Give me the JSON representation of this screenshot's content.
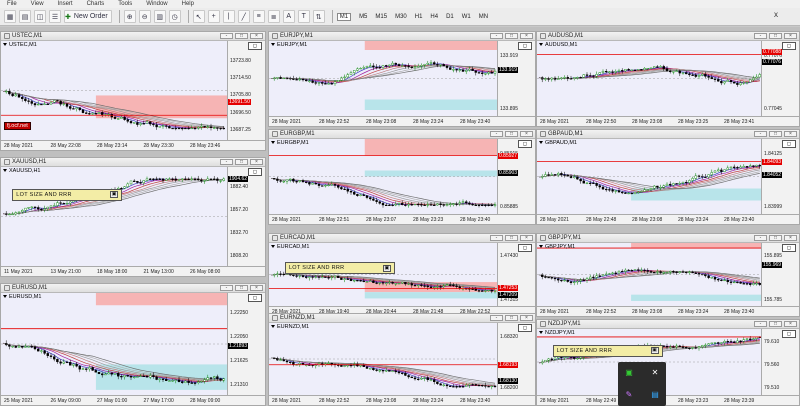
{
  "menu": [
    "File",
    "View",
    "Insert",
    "Charts",
    "Tools",
    "Window",
    "Help"
  ],
  "toolbar": {
    "new_order": "New Order",
    "timeframes": [
      "M1",
      "M5",
      "M15",
      "M30",
      "H1",
      "H4",
      "D1",
      "W1",
      "MN"
    ],
    "active_tf": "M1",
    "close_glyph": "x"
  },
  "panel_buttons": [
    "-",
    "□",
    "×"
  ],
  "overlay": {
    "lot_label": "LOT SIZE AND RRR",
    "watermark": "fj.ocf.net",
    "icon_camera": "camera-icon"
  },
  "colors": {
    "chart_bg": "#eeeefa",
    "bull": "#008000",
    "bear": "#000000",
    "band_red": "#f6b4b4",
    "band_cyan": "#b8e4ea",
    "hline_red": "#e60000",
    "ma_blue": "#4040c0",
    "ma_purple": "#a020a0",
    "ma_gray": "#9a9a9a"
  },
  "charts": [
    {
      "id": "ustec",
      "title": "USTEC,M1",
      "symbol": "USTEC,M1",
      "prices": [
        "13723.80",
        "13714.50",
        "13705.80",
        "13696.50",
        "13687.25"
      ],
      "tag_red": "13691.50",
      "tag_red_pos": 0.62,
      "tag_blk": "",
      "times": [
        "28 May 2021",
        "28 May 22:08",
        "28 May 23:14",
        "28 May 23:30",
        "28 May 23:46"
      ],
      "bands": {
        "red": [
          0.55,
          0.78
        ],
        "cyan": null
      },
      "hline": 0.75,
      "trend": "down",
      "seed": 1,
      "watermark": true,
      "lot": false
    },
    {
      "id": "eurjpy",
      "title": "EURJPY,M1",
      "symbol": "EURJPY,M1",
      "prices": [
        "133.919",
        "133.895"
      ],
      "tag_red": "",
      "tag_red_pos": 0,
      "tag_blk": "133.919",
      "tag_blk_pos": 0.38,
      "times": [
        "28 May 2021",
        "28 May 22:52",
        "28 May 23:08",
        "28 May 23:24",
        "28 May 23:40"
      ],
      "bands": {
        "red": [
          0.0,
          0.12
        ],
        "cyan": [
          0.78,
          0.92
        ]
      },
      "hline": null,
      "trend": "mixed",
      "seed": 2,
      "lot": false
    },
    {
      "id": "audusd",
      "title": "AUDUSD,M1",
      "symbol": "AUDUSD,M1",
      "prices": [
        "0.77076",
        "0.77045"
      ],
      "tag_red": "0.77088",
      "tag_red_pos": 0.15,
      "tag_blk": "0.77076",
      "tag_blk_pos": 0.28,
      "times": [
        "28 May 2021",
        "28 May 22:50",
        "28 May 23:08",
        "28 May 23:25",
        "28 May 23:41"
      ],
      "bands": {
        "red": null,
        "cyan": null
      },
      "hline": 0.18,
      "trend": "mixed",
      "seed": 3,
      "lot": false
    },
    {
      "id": "xauusd",
      "title": "XAUUSD,H1",
      "symbol": "XAUUSD,H1",
      "prices": [
        "1882.40",
        "1857.20",
        "1832.70",
        "1808.20"
      ],
      "tag_red": "",
      "tag_red_pos": 0,
      "tag_blk": "1904.62",
      "tag_blk_pos": 0.12,
      "times": [
        "11 May 2021",
        "13 May 21:00",
        "18 May 18:00",
        "21 May 13:00",
        "26 May 08:00"
      ],
      "bands": {
        "red": null,
        "cyan": null
      },
      "hline": null,
      "trend": "up",
      "seed": 4,
      "lot": true,
      "lot_pos": [
        0.05,
        0.14
      ]
    },
    {
      "id": "eurgbp",
      "title": "EURGBP,M1",
      "symbol": "EURGBP,M1",
      "prices": [
        "0.85915",
        "0.85885"
      ],
      "tag_red": "0.85927",
      "tag_red_pos": 0.22,
      "tag_blk": "0.85903",
      "tag_blk_pos": 0.45,
      "times": [
        "28 May 2021",
        "28 May 22:51",
        "28 May 23:07",
        "28 May 23:23",
        "28 May 23:40"
      ],
      "bands": {
        "red": [
          0.0,
          0.22
        ],
        "cyan": [
          0.42,
          0.5
        ]
      },
      "hline": 0.22,
      "trend": "down",
      "seed": 5,
      "lot": false
    },
    {
      "id": "gbpaud",
      "title": "GBPAUD,M1",
      "symbol": "GBPAUD,M1",
      "prices": [
        "1.84125",
        "1.83999"
      ],
      "tag_red": "1.84093",
      "tag_red_pos": 0.3,
      "tag_blk": "1.84052",
      "tag_blk_pos": 0.48,
      "times": [
        "28 May 2021",
        "28 May 22:48",
        "28 May 23:08",
        "28 May 23:24",
        "28 May 23:40"
      ],
      "bands": {
        "red": null,
        "cyan": [
          0.66,
          0.82
        ]
      },
      "hline": 0.3,
      "trend": "mixed",
      "seed": 6,
      "lot": false
    },
    {
      "id": "eurcad",
      "title": "EURCAD,M1",
      "symbol": "EURCAD,M1",
      "prices": [
        "1.47430",
        "1.47315"
      ],
      "tag_red": "1.47253",
      "tag_red_pos": 0.72,
      "tag_blk": "1.47209",
      "tag_blk_pos": 0.83,
      "times": [
        "28 May 2021",
        "28 May 19:40",
        "28 May 20:44",
        "28 May 21:48",
        "28 May 22:52"
      ],
      "bands": {
        "red": [
          0.62,
          0.78
        ],
        "cyan": [
          0.78,
          0.88
        ]
      },
      "hline": 0.72,
      "trend": "down",
      "seed": 7,
      "lot": true,
      "lot_pos": [
        0.07,
        0.18
      ]
    },
    {
      "id": "gbpjpy",
      "title": "GBPJPY,M1",
      "symbol": "GBPJPY,M1",
      "prices": [
        "155.895",
        "155.785"
      ],
      "tag_red": "",
      "tag_red_pos": 0,
      "tag_blk": "155.969",
      "tag_blk_pos": 0.35,
      "times": [
        "28 May 2021",
        "28 May 22:52",
        "28 May 23:08",
        "28 May 23:24",
        "28 May 23:40"
      ],
      "bands": {
        "red": [
          0.0,
          0.08
        ],
        "cyan": [
          0.82,
          0.92
        ]
      },
      "hline": 0.08,
      "trend": "mixed",
      "seed": 8,
      "lot": false
    },
    {
      "id": "eurusd",
      "title": "EURUSD,M1",
      "symbol": "EURUSD,M1",
      "prices": [
        "1.22250",
        "1.22050",
        "1.21625",
        "1.21310"
      ],
      "tag_red": "",
      "tag_red_pos": 0,
      "tag_blk": "1.21893",
      "tag_blk_pos": 0.52,
      "times": [
        "25 May 2021",
        "26 May 09:00",
        "27 May 01:00",
        "27 May 17:00",
        "28 May 09:00"
      ],
      "bands": {
        "red": [
          0.0,
          0.12
        ],
        "cyan": [
          0.7,
          0.95
        ]
      },
      "hline": 0.35,
      "trend": "down",
      "seed": 9,
      "lot": false
    },
    {
      "id": "eurnzd",
      "title": "EURNZD,M1",
      "symbol": "EURNZD,M1",
      "prices": [
        "1.68320",
        "1.68200"
      ],
      "tag_red": "1.68193",
      "tag_red_pos": 0.58,
      "tag_blk": "1.68130",
      "tag_blk_pos": 0.8,
      "times": [
        "28 May 2021",
        "28 May 22:52",
        "28 May 23:08",
        "28 May 23:24",
        "28 May 23:40"
      ],
      "bands": {
        "red": null,
        "cyan": null
      },
      "hline": 0.58,
      "trend": "down",
      "seed": 10,
      "lot": false
    },
    {
      "id": "nzdjpy",
      "title": "NZDJPY,M1",
      "symbol": "NZDJPY,M1",
      "prices": [
        "79.610",
        "79.560",
        "79.510"
      ],
      "tag_red": "",
      "tag_red_pos": 0,
      "tag_blk": "",
      "times": [
        "28 May 2021",
        "28 May 22:49",
        "28 May 23:07",
        "28 May 23:23",
        "28 May 23:39"
      ],
      "bands": {
        "red": null,
        "cyan": null
      },
      "hline": 0.12,
      "trend": "up",
      "seed": 11,
      "lot": true,
      "lot_pos": [
        0.07,
        0.12
      ]
    }
  ]
}
